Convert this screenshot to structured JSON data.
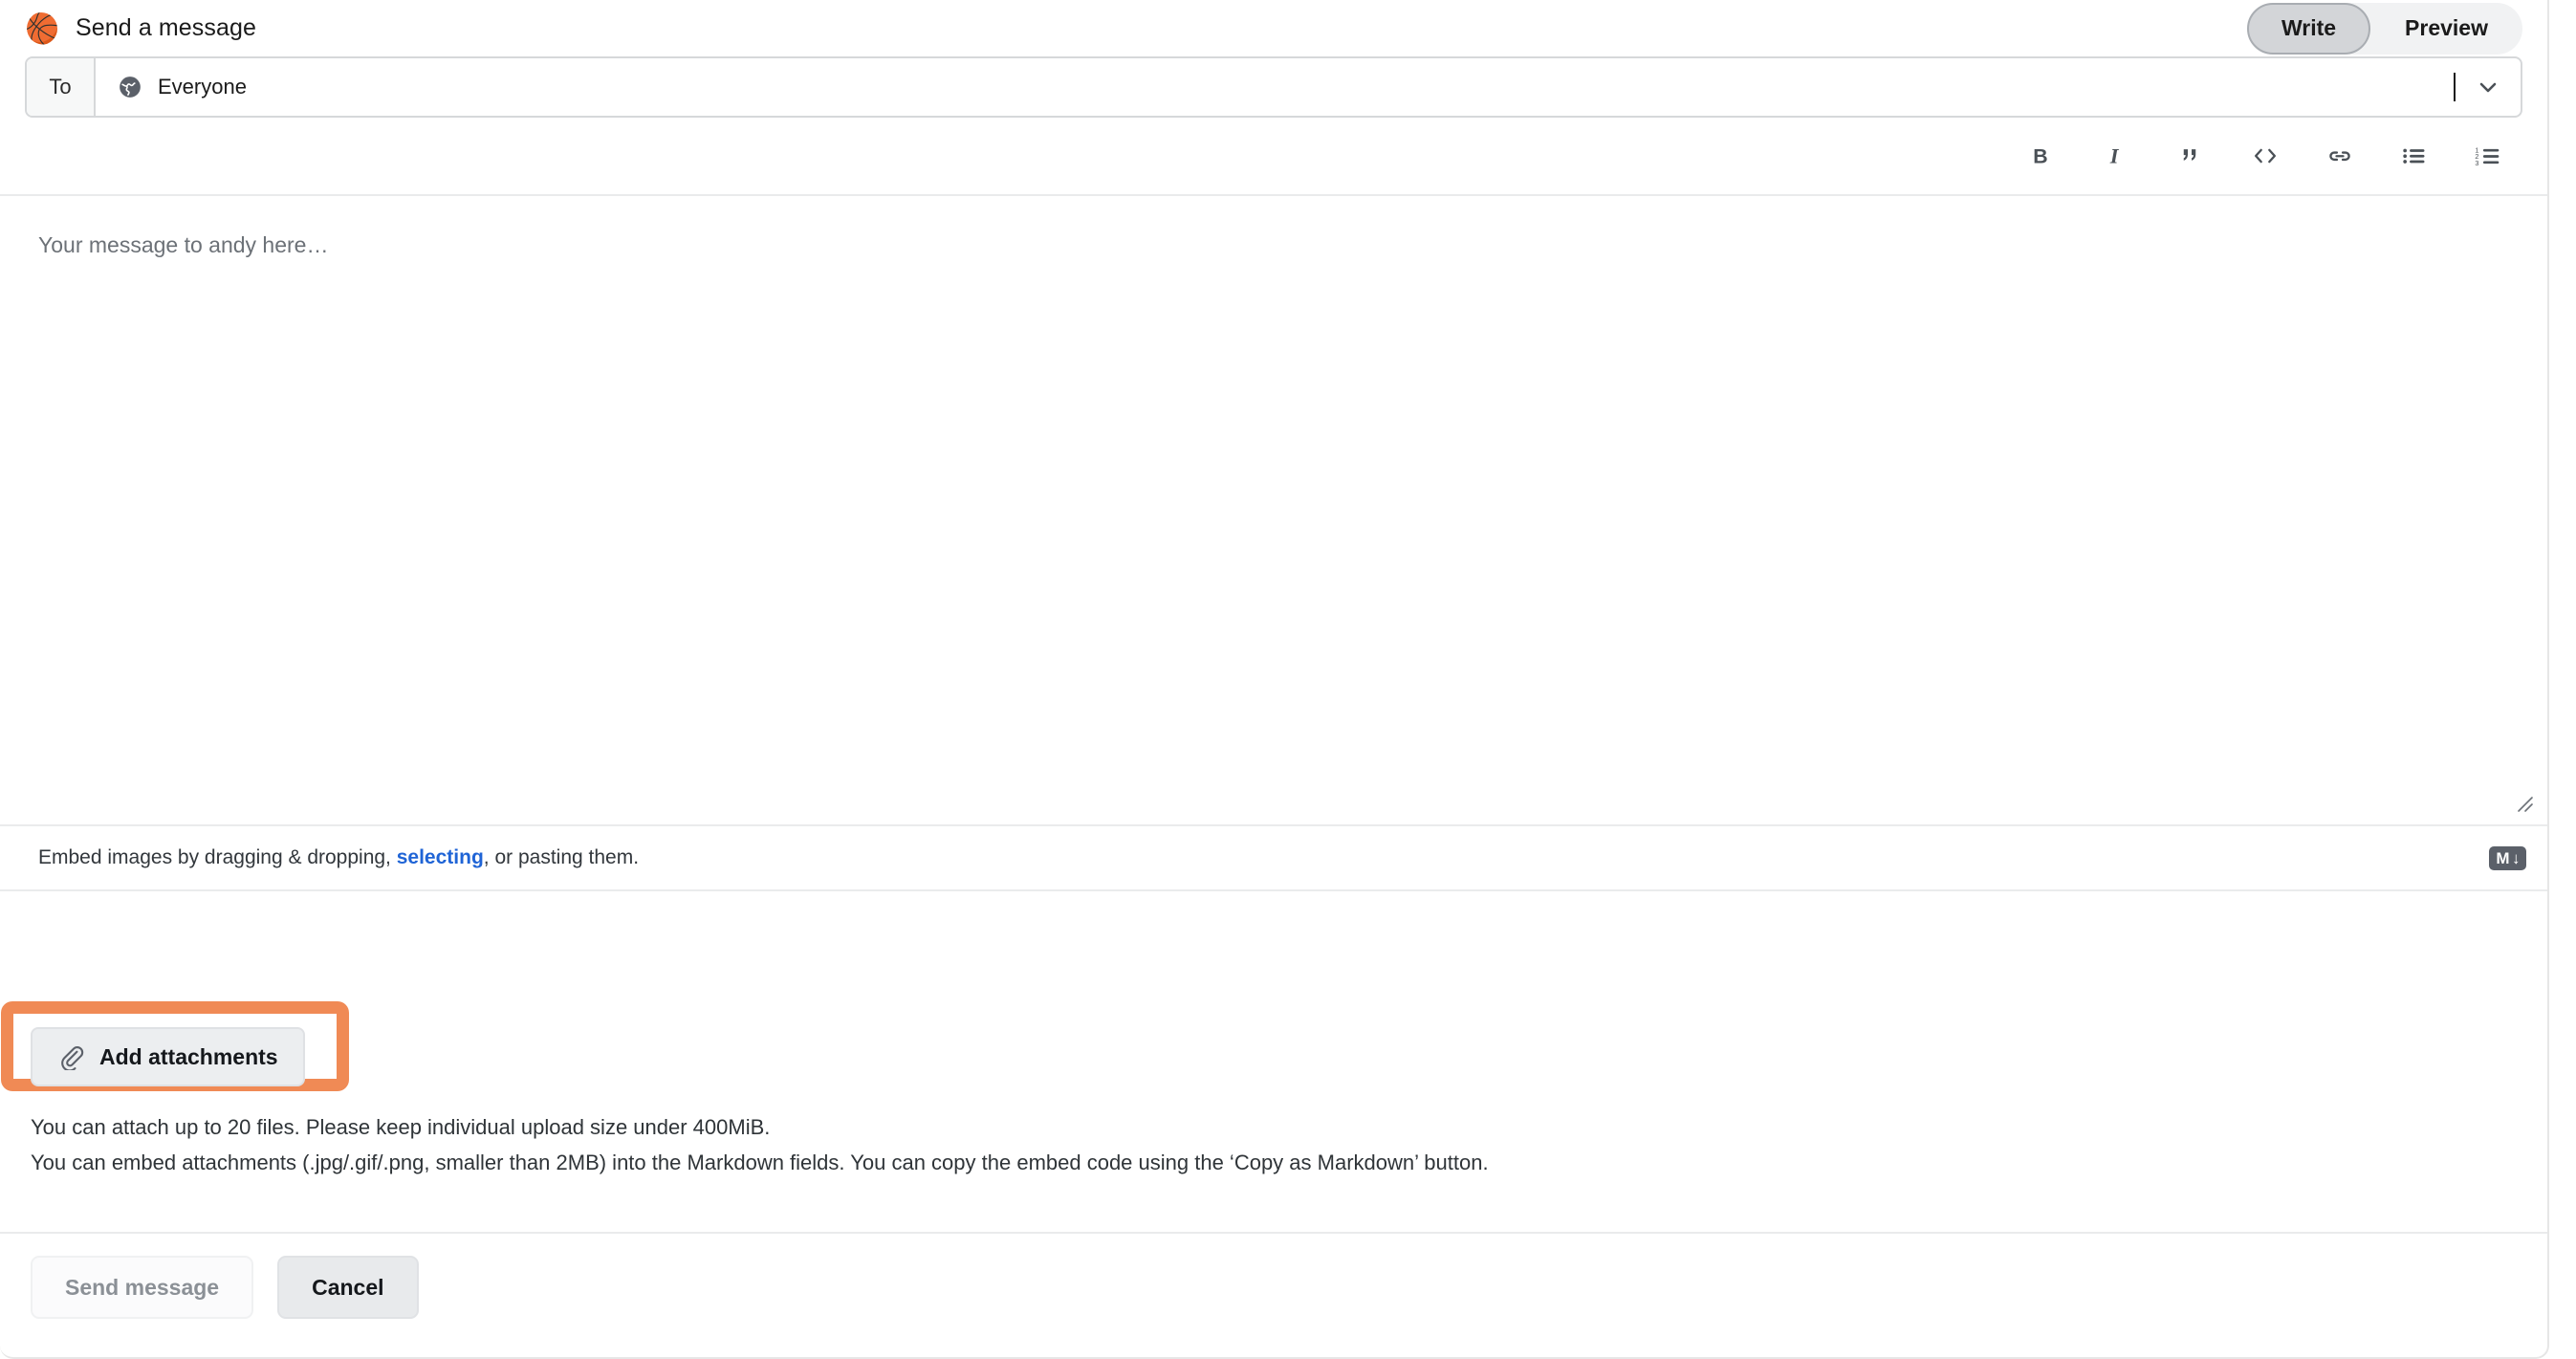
{
  "header": {
    "avatar_icon": "basketball-avatar",
    "avatar_glyph": "🏀",
    "title": "Send a message",
    "tabs": [
      {
        "label": "Write",
        "name": "write",
        "active": true
      },
      {
        "label": "Preview",
        "name": "preview",
        "active": false
      }
    ]
  },
  "recipient": {
    "label": "To",
    "icon": "globe-icon",
    "value": "Everyone",
    "dropdown_icon": "chevron-down-icon",
    "caret_visible": true
  },
  "toolbar": {
    "items": [
      {
        "name": "bold",
        "label": "B",
        "title": "Bold"
      },
      {
        "name": "italic",
        "label": "I",
        "title": "Italic"
      },
      {
        "name": "quote",
        "label": "”",
        "title": "Quote"
      },
      {
        "name": "code",
        "label": "<>",
        "title": "Code"
      },
      {
        "name": "link",
        "label": "link",
        "title": "Link"
      },
      {
        "name": "unordered-list",
        "label": "ul",
        "title": "Unordered list"
      },
      {
        "name": "ordered-list",
        "label": "ol",
        "title": "Ordered list"
      }
    ]
  },
  "message": {
    "placeholder": "Your message to andy here…",
    "value": "",
    "resize_handle": "resize-grip-icon"
  },
  "embed": {
    "text_before": "Embed images by dragging & dropping, ",
    "link_text": "selecting",
    "text_after": ", or pasting them.",
    "markdown_badge": "M",
    "markdown_badge_arrow": "↓"
  },
  "attachments": {
    "button_label": "Add attachments",
    "button_icon": "paperclip-icon",
    "highlighted": true,
    "highlight_color": "#f08a55",
    "note_1": "You can attach up to 20 files. Please keep individual upload size under 400MiB.",
    "note_2": "You can embed attachments (.jpg/.gif/.png, smaller than 2MB) into the Markdown fields. You can copy the embed code using the ‘Copy as Markdown’ button."
  },
  "footer": {
    "send_label": "Send message",
    "send_disabled": true,
    "cancel_label": "Cancel"
  }
}
